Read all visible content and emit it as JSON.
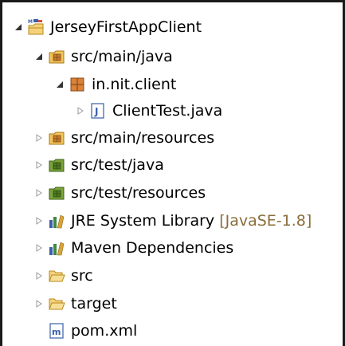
{
  "tree": {
    "project": {
      "label": "JerseyFirstAppClient",
      "icon": "maven-project-icon",
      "expanded": true
    },
    "src_main_java": {
      "label": "src/main/java",
      "icon": "source-folder-icon",
      "expanded": true
    },
    "package": {
      "label": "in.nit.client",
      "icon": "package-icon",
      "expanded": true
    },
    "client_test": {
      "label": "ClientTest.java",
      "icon": "java-file-icon",
      "expanded": false
    },
    "src_main_resources": {
      "label": "src/main/resources",
      "icon": "source-folder-icon",
      "expanded": false
    },
    "src_test_java": {
      "label": "src/test/java",
      "icon": "test-source-folder-icon",
      "expanded": false
    },
    "src_test_resources": {
      "label": "src/test/resources",
      "icon": "test-source-folder-icon",
      "expanded": false
    },
    "jre": {
      "label": "JRE System Library",
      "decoration": "[JavaSE-1.8]",
      "icon": "library-icon",
      "expanded": false
    },
    "maven_deps": {
      "label": "Maven Dependencies",
      "icon": "library-icon",
      "expanded": false
    },
    "src": {
      "label": "src",
      "icon": "folder-icon",
      "expanded": false
    },
    "target": {
      "label": "target",
      "icon": "folder-icon",
      "expanded": false
    },
    "pom": {
      "label": "pom.xml",
      "icon": "maven-file-icon"
    }
  },
  "colors": {
    "decoration": "#8a6d3b",
    "folder": "#e8b43a",
    "test_folder": "#5f8f2a",
    "twisty_expanded": "#333333",
    "twisty_collapsed": "#9a9a9a"
  }
}
